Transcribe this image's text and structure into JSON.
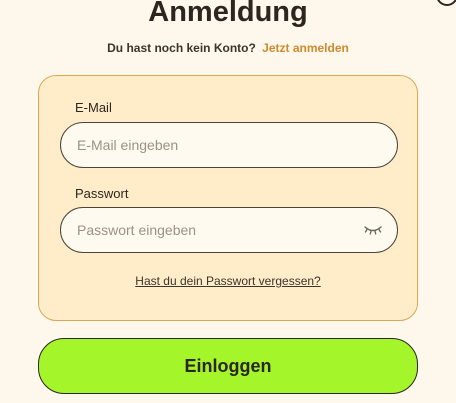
{
  "title": "Anmeldung",
  "signup": {
    "prompt": "Du hast noch kein Konto?",
    "link": "Jetzt anmelden"
  },
  "email": {
    "label": "E-Mail",
    "placeholder": "E-Mail eingeben"
  },
  "password": {
    "label": "Passwort",
    "placeholder": "Passwort eingeben",
    "toggle_icon": "eye-closed-icon"
  },
  "forgot_link": "Hast du dein Passwort vergessen?",
  "login_label": "Einloggen",
  "colors": {
    "background": "#fdf7ec",
    "card": "#ffecc9",
    "accent_link": "#d18a2c",
    "button": "#a4f52a"
  }
}
